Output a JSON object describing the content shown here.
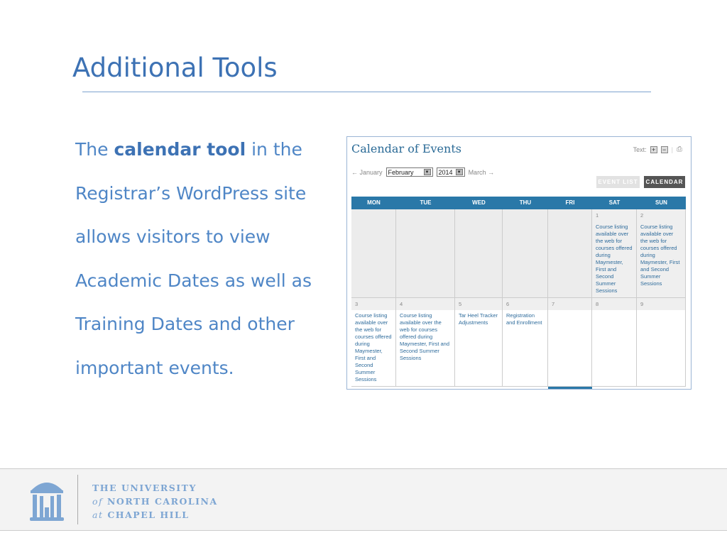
{
  "slide": {
    "title": "Additional Tools",
    "body_pre": "The ",
    "body_bold": "calendar tool",
    "body_post": " in the Registrar’s WordPress site allows visitors to view Academic Dates as well as Training Dates and other important events."
  },
  "calendar": {
    "title": "Calendar of Events",
    "text_label": "Text:",
    "prev": "← January",
    "month": "February",
    "year": "2014",
    "next": "March →",
    "event_list": "EVENT LIST",
    "calendar_btn": "CALENDAR",
    "days": [
      "MON",
      "TUE",
      "WED",
      "THU",
      "FRI",
      "SAT",
      "SUN"
    ],
    "weeks": [
      [
        {
          "n": "",
          "t": ""
        },
        {
          "n": "",
          "t": ""
        },
        {
          "n": "",
          "t": ""
        },
        {
          "n": "",
          "t": ""
        },
        {
          "n": "",
          "t": ""
        },
        {
          "n": "1",
          "t": "Course listing available over the web for courses offered during Maymester, First and Second Summer Sessions"
        },
        {
          "n": "2",
          "t": "Course listing available over the web for courses offered during Maymester, First and Second Summer Sessions"
        }
      ],
      [
        {
          "n": "3",
          "t": "Course listing available over the web for courses offered during Maymester, First and Second Summer Sessions"
        },
        {
          "n": "4",
          "t": "Course listing available over the web for courses offered during Maymester, First and Second Summer Sessions"
        },
        {
          "n": "5",
          "t": "Tar Heel Tracker Adjustments"
        },
        {
          "n": "6",
          "t": "Registration and Enrollment"
        },
        {
          "n": "7",
          "t": ""
        },
        {
          "n": "8",
          "t": ""
        },
        {
          "n": "9",
          "t": ""
        }
      ]
    ]
  },
  "footer": {
    "line1": "THE UNIVERSITY",
    "line2_of": "of",
    "line2": " NORTH CAROLINA",
    "line3_at": "at",
    "line3": " CHAPEL HILL"
  },
  "colors": {
    "accent": "#3d72b4",
    "calendar_header": "#2a78a8"
  }
}
